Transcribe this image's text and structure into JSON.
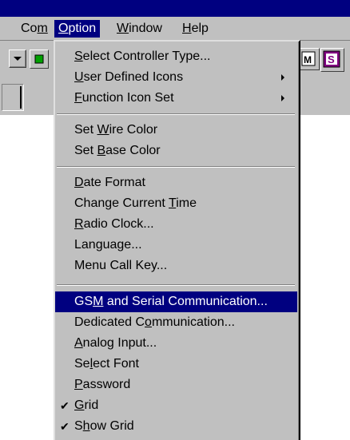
{
  "menubar": {
    "items": [
      {
        "id": "com",
        "pre": "Co",
        "acc": "m",
        "post": ""
      },
      {
        "id": "option",
        "pre": "",
        "acc": "O",
        "post": "ption"
      },
      {
        "id": "window",
        "pre": "",
        "acc": "W",
        "post": "indow"
      },
      {
        "id": "help",
        "pre": "",
        "acc": "H",
        "post": "elp"
      }
    ]
  },
  "toolbar": {
    "icon_r1_text": "M",
    "icon_r2_text": "S"
  },
  "menu": {
    "items": [
      {
        "pre": "",
        "acc": "S",
        "post": "elect Controller Type..."
      },
      {
        "pre": "",
        "acc": "U",
        "post": "ser Defined Icons"
      },
      {
        "pre": "",
        "acc": "F",
        "post": "unction Icon Set"
      },
      {
        "pre": "Set ",
        "acc": "W",
        "post": "ire Color"
      },
      {
        "pre": "Set ",
        "acc": "B",
        "post": "ase Color"
      },
      {
        "pre": "",
        "acc": "D",
        "post": "ate Format"
      },
      {
        "pre": "Change Current ",
        "acc": "T",
        "post": "ime"
      },
      {
        "pre": "",
        "acc": "R",
        "post": "adio Clock..."
      },
      {
        "pre": "Language...",
        "acc": "",
        "post": ""
      },
      {
        "pre": "Menu Call Key...",
        "acc": "",
        "post": ""
      },
      {
        "pre": "GS",
        "acc": "M",
        "post": " and Serial Communication..."
      },
      {
        "pre": "Dedicated C",
        "acc": "o",
        "post": "mmunication..."
      },
      {
        "pre": "",
        "acc": "A",
        "post": "nalog Input..."
      },
      {
        "pre": "Se",
        "acc": "l",
        "post": "ect Font"
      },
      {
        "pre": "",
        "acc": "P",
        "post": "assword"
      },
      {
        "pre": "",
        "acc": "G",
        "post": "rid"
      },
      {
        "pre": "S",
        "acc": "h",
        "post": "ow Grid"
      }
    ],
    "checkmark": "✔"
  }
}
